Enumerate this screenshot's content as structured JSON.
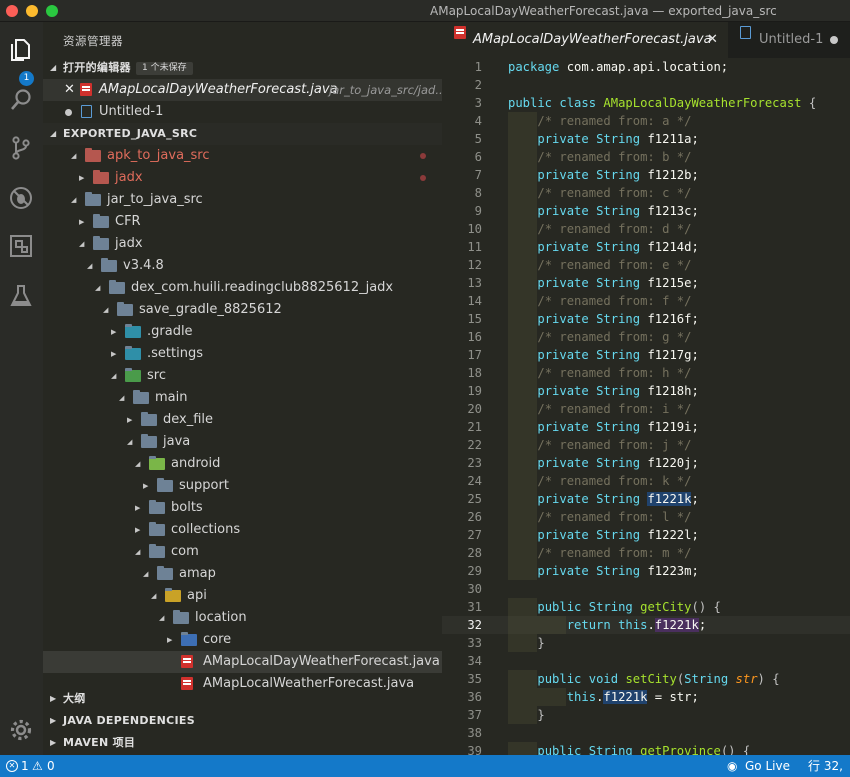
{
  "window": {
    "title": "AMapLocalDayWeatherForecast.java — exported_java_src"
  },
  "activity_bar": {
    "explorer_badge": "1"
  },
  "sidebar": {
    "title": "资源管理器",
    "open_editors": {
      "label": "打开的编辑器",
      "badge": "1 个未保存",
      "items": [
        {
          "name": "AMapLocalDayWeatherForecast.java",
          "path": "jar_to_java_src/jad..."
        },
        {
          "name": "Untitled-1"
        }
      ]
    },
    "explorer_section": "EXPORTED_JAVA_SRC",
    "tree": [
      {
        "name": "apk_to_java_src",
        "modified": true
      },
      {
        "name": "jadx",
        "modified": true
      },
      {
        "name": "jar_to_java_src"
      },
      {
        "name": "CFR"
      },
      {
        "name": "jadx"
      },
      {
        "name": "v3.4.8"
      },
      {
        "name": "dex_com.huili.readingclub8825612_jadx"
      },
      {
        "name": "save_gradle_8825612"
      },
      {
        "name": ".gradle"
      },
      {
        "name": ".settings"
      },
      {
        "name": "src"
      },
      {
        "name": "main"
      },
      {
        "name": "dex_file"
      },
      {
        "name": "java"
      },
      {
        "name": "android"
      },
      {
        "name": "support"
      },
      {
        "name": "bolts"
      },
      {
        "name": "collections"
      },
      {
        "name": "com"
      },
      {
        "name": "amap"
      },
      {
        "name": "api"
      },
      {
        "name": "location"
      },
      {
        "name": "core"
      },
      {
        "name": "AMapLocalDayWeatherForecast.java"
      },
      {
        "name": "AMapLocalWeatherForecast.java"
      }
    ],
    "bottom_sections": [
      "大纲",
      "JAVA DEPENDENCIES",
      "MAVEN 项目"
    ]
  },
  "tabs": [
    {
      "label": "AMapLocalDayWeatherForecast.java"
    },
    {
      "label": "Untitled-1"
    }
  ],
  "code_lines": {
    "package": "com.amap.api.location;",
    "class_name": "AMapLocalDayWeatherForecast",
    "fields": [
      {
        "comment": "/* renamed from: a */",
        "name": "f1211a;"
      },
      {
        "comment": "/* renamed from: b */",
        "name": "f1212b;"
      },
      {
        "comment": "/* renamed from: c */",
        "name": "f1213c;"
      },
      {
        "comment": "/* renamed from: d */",
        "name": "f1214d;"
      },
      {
        "comment": "/* renamed from: e */",
        "name": "f1215e;"
      },
      {
        "comment": "/* renamed from: f */",
        "name": "f1216f;"
      },
      {
        "comment": "/* renamed from: g */",
        "name": "f1217g;"
      },
      {
        "comment": "/* renamed from: h */",
        "name": "f1218h;"
      },
      {
        "comment": "/* renamed from: i */",
        "name": "f1219i;"
      },
      {
        "comment": "/* renamed from: j */",
        "name": "f1220j;"
      },
      {
        "comment": "/* renamed from: k */",
        "name": "f1221k"
      },
      {
        "comment": "/* renamed from: l */",
        "name": "f1222l;"
      },
      {
        "comment": "/* renamed from: m */",
        "name": "f1223m;"
      }
    ],
    "method_get_city": "getCity",
    "method_set_city": "setCity",
    "param": "str",
    "field_ref": "f1221k",
    "method_get_province": "getProvince"
  },
  "status": {
    "errors": "1",
    "warnings": "0",
    "go_live": "Go Live",
    "cursor": "行 32,"
  },
  "colors": {
    "accent": "#1479c9",
    "keyword": "#66d9ef",
    "class": "#a6e22e",
    "comment": "#75715e"
  }
}
